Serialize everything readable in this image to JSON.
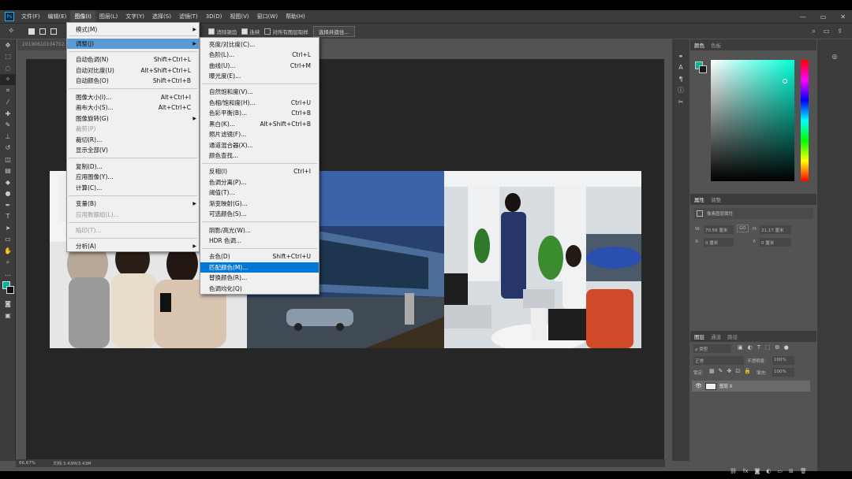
{
  "app": {
    "logo": "Ps"
  },
  "menubar": {
    "items": [
      "文件(F)",
      "编辑(E)",
      "图像(I)",
      "图层(L)",
      "文字(Y)",
      "选择(S)",
      "滤镜(T)",
      "3D(D)",
      "视图(V)",
      "窗口(W)",
      "帮助(H)"
    ],
    "active_index": 2,
    "window_controls": [
      "—",
      "▭",
      "✕"
    ]
  },
  "options_bar": {
    "check1": "消除锯齿",
    "check2": "连续",
    "check3": "对所有图层取样",
    "button": "选择并遮住..."
  },
  "document": {
    "tab": "20190610104752...",
    "zoom": "66.67%",
    "doc_info": "文档:3.43M/3.43M"
  },
  "image_menu": {
    "items": [
      {
        "label": "模式(M)",
        "shortcut": "",
        "submenu": true,
        "disabled": false
      },
      {
        "label": "调整(J)",
        "shortcut": "",
        "submenu": true,
        "disabled": false,
        "highlighted": true
      },
      {
        "label": "自动色调(N)",
        "shortcut": "Shift+Ctrl+L"
      },
      {
        "label": "自动对比度(U)",
        "shortcut": "Alt+Shift+Ctrl+L"
      },
      {
        "label": "自动颜色(O)",
        "shortcut": "Shift+Ctrl+B"
      },
      {
        "label": "图像大小(I)...",
        "shortcut": "Alt+Ctrl+I"
      },
      {
        "label": "画布大小(S)...",
        "shortcut": "Alt+Ctrl+C"
      },
      {
        "label": "图像旋转(G)",
        "shortcut": "",
        "submenu": true
      },
      {
        "label": "裁剪(P)",
        "shortcut": "",
        "disabled": true
      },
      {
        "label": "裁切(R)...",
        "shortcut": ""
      },
      {
        "label": "显示全部(V)",
        "shortcut": ""
      },
      {
        "label": "复制(D)...",
        "shortcut": ""
      },
      {
        "label": "应用图像(Y)...",
        "shortcut": ""
      },
      {
        "label": "计算(C)...",
        "shortcut": ""
      },
      {
        "label": "变量(B)",
        "shortcut": "",
        "submenu": true
      },
      {
        "label": "应用数据组(L)...",
        "shortcut": "",
        "disabled": true
      },
      {
        "label": "陷印(T)...",
        "shortcut": "",
        "disabled": true
      },
      {
        "label": "分析(A)",
        "shortcut": "",
        "submenu": true
      }
    ]
  },
  "adjust_menu": {
    "items": [
      {
        "label": "亮度/对比度(C)...",
        "shortcut": ""
      },
      {
        "label": "色阶(L)...",
        "shortcut": "Ctrl+L"
      },
      {
        "label": "曲线(U)...",
        "shortcut": "Ctrl+M"
      },
      {
        "label": "曝光度(E)...",
        "shortcut": ""
      },
      {
        "label": "自然饱和度(V)...",
        "shortcut": ""
      },
      {
        "label": "色相/饱和度(H)...",
        "shortcut": "Ctrl+U"
      },
      {
        "label": "色彩平衡(B)...",
        "shortcut": "Ctrl+B"
      },
      {
        "label": "黑白(K)...",
        "shortcut": "Alt+Shift+Ctrl+B"
      },
      {
        "label": "照片滤镜(F)...",
        "shortcut": ""
      },
      {
        "label": "通道混合器(X)...",
        "shortcut": ""
      },
      {
        "label": "颜色查找...",
        "shortcut": ""
      },
      {
        "label": "反相(I)",
        "shortcut": "Ctrl+I"
      },
      {
        "label": "色调分离(P)...",
        "shortcut": ""
      },
      {
        "label": "阈值(T)...",
        "shortcut": ""
      },
      {
        "label": "渐变映射(G)...",
        "shortcut": ""
      },
      {
        "label": "可选颜色(S)...",
        "shortcut": ""
      },
      {
        "label": "阴影/高光(W)...",
        "shortcut": ""
      },
      {
        "label": "HDR 色调...",
        "shortcut": ""
      },
      {
        "label": "去色(D)",
        "shortcut": "Shift+Ctrl+U"
      },
      {
        "label": "匹配颜色(M)...",
        "shortcut": "",
        "highlighted": true
      },
      {
        "label": "替换颜色(R)...",
        "shortcut": ""
      },
      {
        "label": "色调均化(Q)",
        "shortcut": ""
      }
    ]
  },
  "color_panel": {
    "tabs": [
      "颜色",
      "色板"
    ],
    "foreground": "#00b4a0",
    "background": "#1a1a1a",
    "picker_hue": "#00ffd8"
  },
  "properties_panel": {
    "tabs": [
      "属性",
      "调整"
    ],
    "header": "像素图层属性",
    "w_label": "W:",
    "w_value": "70.56 厘米",
    "link": "GO",
    "h_label": "H:",
    "h_value": "21.17 厘米",
    "x_label": "X:",
    "x_value": "0 厘米",
    "y_label": "Y:",
    "y_value": "0 厘米"
  },
  "layers_panel": {
    "tabs": [
      "图层",
      "通道",
      "路径"
    ],
    "filter": "ρ 类型",
    "blend_mode": "正常",
    "opacity_label": "不透明度:",
    "opacity_value": "100%",
    "lock_label": "锁定:",
    "fill_label": "填充:",
    "fill_value": "100%",
    "layer_name": "图层 0"
  }
}
